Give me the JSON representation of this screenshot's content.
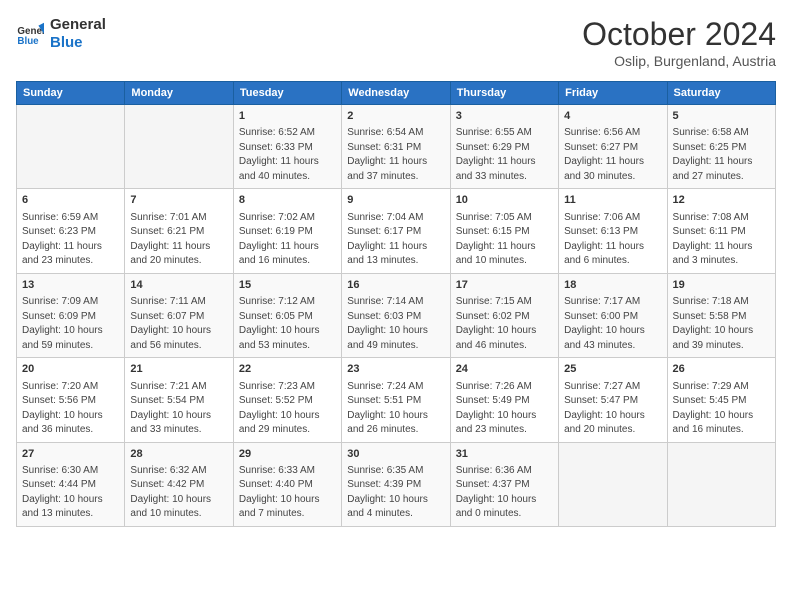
{
  "logo": {
    "line1": "General",
    "line2": "Blue"
  },
  "title": "October 2024",
  "location": "Oslip, Burgenland, Austria",
  "weekdays": [
    "Sunday",
    "Monday",
    "Tuesday",
    "Wednesday",
    "Thursday",
    "Friday",
    "Saturday"
  ],
  "weeks": [
    [
      {
        "day": "",
        "info": ""
      },
      {
        "day": "",
        "info": ""
      },
      {
        "day": "1",
        "info": "Sunrise: 6:52 AM\nSunset: 6:33 PM\nDaylight: 11 hours and 40 minutes."
      },
      {
        "day": "2",
        "info": "Sunrise: 6:54 AM\nSunset: 6:31 PM\nDaylight: 11 hours and 37 minutes."
      },
      {
        "day": "3",
        "info": "Sunrise: 6:55 AM\nSunset: 6:29 PM\nDaylight: 11 hours and 33 minutes."
      },
      {
        "day": "4",
        "info": "Sunrise: 6:56 AM\nSunset: 6:27 PM\nDaylight: 11 hours and 30 minutes."
      },
      {
        "day": "5",
        "info": "Sunrise: 6:58 AM\nSunset: 6:25 PM\nDaylight: 11 hours and 27 minutes."
      }
    ],
    [
      {
        "day": "6",
        "info": "Sunrise: 6:59 AM\nSunset: 6:23 PM\nDaylight: 11 hours and 23 minutes."
      },
      {
        "day": "7",
        "info": "Sunrise: 7:01 AM\nSunset: 6:21 PM\nDaylight: 11 hours and 20 minutes."
      },
      {
        "day": "8",
        "info": "Sunrise: 7:02 AM\nSunset: 6:19 PM\nDaylight: 11 hours and 16 minutes."
      },
      {
        "day": "9",
        "info": "Sunrise: 7:04 AM\nSunset: 6:17 PM\nDaylight: 11 hours and 13 minutes."
      },
      {
        "day": "10",
        "info": "Sunrise: 7:05 AM\nSunset: 6:15 PM\nDaylight: 11 hours and 10 minutes."
      },
      {
        "day": "11",
        "info": "Sunrise: 7:06 AM\nSunset: 6:13 PM\nDaylight: 11 hours and 6 minutes."
      },
      {
        "day": "12",
        "info": "Sunrise: 7:08 AM\nSunset: 6:11 PM\nDaylight: 11 hours and 3 minutes."
      }
    ],
    [
      {
        "day": "13",
        "info": "Sunrise: 7:09 AM\nSunset: 6:09 PM\nDaylight: 10 hours and 59 minutes."
      },
      {
        "day": "14",
        "info": "Sunrise: 7:11 AM\nSunset: 6:07 PM\nDaylight: 10 hours and 56 minutes."
      },
      {
        "day": "15",
        "info": "Sunrise: 7:12 AM\nSunset: 6:05 PM\nDaylight: 10 hours and 53 minutes."
      },
      {
        "day": "16",
        "info": "Sunrise: 7:14 AM\nSunset: 6:03 PM\nDaylight: 10 hours and 49 minutes."
      },
      {
        "day": "17",
        "info": "Sunrise: 7:15 AM\nSunset: 6:02 PM\nDaylight: 10 hours and 46 minutes."
      },
      {
        "day": "18",
        "info": "Sunrise: 7:17 AM\nSunset: 6:00 PM\nDaylight: 10 hours and 43 minutes."
      },
      {
        "day": "19",
        "info": "Sunrise: 7:18 AM\nSunset: 5:58 PM\nDaylight: 10 hours and 39 minutes."
      }
    ],
    [
      {
        "day": "20",
        "info": "Sunrise: 7:20 AM\nSunset: 5:56 PM\nDaylight: 10 hours and 36 minutes."
      },
      {
        "day": "21",
        "info": "Sunrise: 7:21 AM\nSunset: 5:54 PM\nDaylight: 10 hours and 33 minutes."
      },
      {
        "day": "22",
        "info": "Sunrise: 7:23 AM\nSunset: 5:52 PM\nDaylight: 10 hours and 29 minutes."
      },
      {
        "day": "23",
        "info": "Sunrise: 7:24 AM\nSunset: 5:51 PM\nDaylight: 10 hours and 26 minutes."
      },
      {
        "day": "24",
        "info": "Sunrise: 7:26 AM\nSunset: 5:49 PM\nDaylight: 10 hours and 23 minutes."
      },
      {
        "day": "25",
        "info": "Sunrise: 7:27 AM\nSunset: 5:47 PM\nDaylight: 10 hours and 20 minutes."
      },
      {
        "day": "26",
        "info": "Sunrise: 7:29 AM\nSunset: 5:45 PM\nDaylight: 10 hours and 16 minutes."
      }
    ],
    [
      {
        "day": "27",
        "info": "Sunrise: 6:30 AM\nSunset: 4:44 PM\nDaylight: 10 hours and 13 minutes."
      },
      {
        "day": "28",
        "info": "Sunrise: 6:32 AM\nSunset: 4:42 PM\nDaylight: 10 hours and 10 minutes."
      },
      {
        "day": "29",
        "info": "Sunrise: 6:33 AM\nSunset: 4:40 PM\nDaylight: 10 hours and 7 minutes."
      },
      {
        "day": "30",
        "info": "Sunrise: 6:35 AM\nSunset: 4:39 PM\nDaylight: 10 hours and 4 minutes."
      },
      {
        "day": "31",
        "info": "Sunrise: 6:36 AM\nSunset: 4:37 PM\nDaylight: 10 hours and 0 minutes."
      },
      {
        "day": "",
        "info": ""
      },
      {
        "day": "",
        "info": ""
      }
    ]
  ]
}
